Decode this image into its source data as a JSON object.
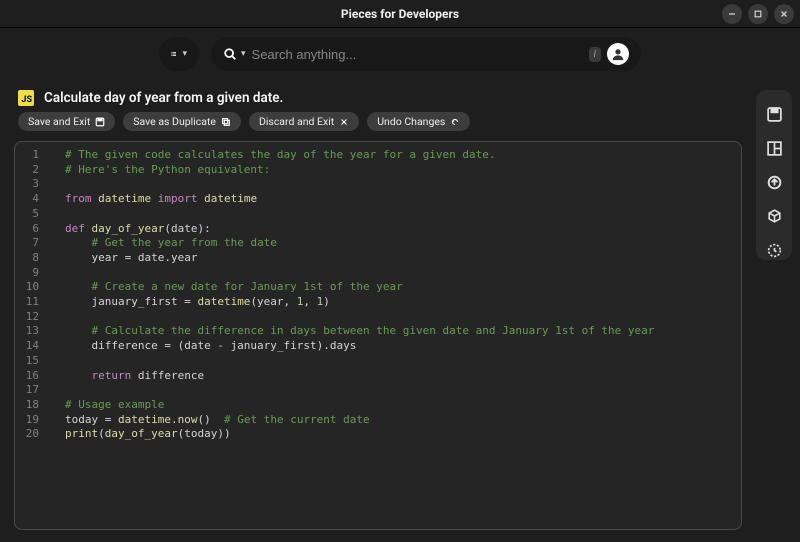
{
  "titlebar": {
    "title": "Pieces for Developers"
  },
  "search": {
    "placeholder": "Search anything...",
    "kbd": "i"
  },
  "snippet": {
    "badge": "JS",
    "title": "Calculate day of year from a given date."
  },
  "actions": {
    "save_exit": "Save and Exit",
    "save_duplicate": "Save as Duplicate",
    "discard_exit": "Discard and Exit",
    "undo": "Undo Changes"
  },
  "code_lines": [
    "# The given code calculates the day of the year for a given date.",
    "# Here's the Python equivalent:",
    "",
    "from datetime import datetime",
    "",
    "def day_of_year(date):",
    "    # Get the year from the date",
    "    year = date.year",
    "",
    "    # Create a new date for January 1st of the year",
    "    january_first = datetime(year, 1, 1)",
    "",
    "    # Calculate the difference in days between the given date and January 1st of the year",
    "    difference = (date - january_first).days",
    "",
    "    return difference",
    "",
    "# Usage example",
    "today = datetime.now()  # Get the current date",
    "print(day_of_year(today))"
  ]
}
